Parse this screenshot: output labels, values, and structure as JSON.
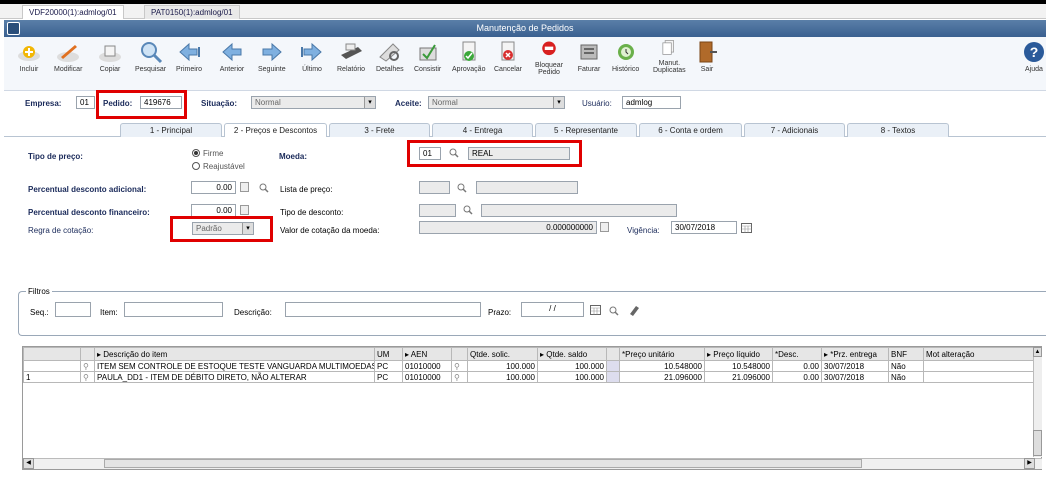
{
  "window_tabs": [
    {
      "label": "VDF20000(1):admlog/01",
      "active": true
    },
    {
      "label": "PAT0150(1):admlog/01",
      "active": false
    }
  ],
  "window_title": "Manutenção de Pedidos",
  "toolbar": {
    "incluir": "Incluir",
    "modificar": "Modificar",
    "copiar": "Copiar",
    "pesquisar": "Pesquisar",
    "primeiro": "Primeiro",
    "anterior": "Anterior",
    "seguinte": "Seguinte",
    "ultimo": "Último",
    "relatorio": "Relatório",
    "detalhes": "Detalhes",
    "consistir": "Consistir",
    "aprovacao": "Aprovação",
    "cancelar": "Cancelar",
    "bloquear_l1": "Bloquear",
    "bloquear_l2": "Pedido",
    "faturar": "Faturar",
    "historico": "Histórico",
    "manut_l1": "Manut.",
    "manut_l2": "Duplicatas",
    "sair": "Sair",
    "ajuda": "Ajuda"
  },
  "header": {
    "empresa_label": "Empresa:",
    "empresa_value": "01",
    "pedido_label": "Pedido:",
    "pedido_value": "419676",
    "situacao_label": "Situação:",
    "situacao_value": "Normal",
    "aceite_label": "Aceite:",
    "aceite_value": "Normal",
    "usuario_label": "Usuário:",
    "usuario_value": "admlog"
  },
  "form_tabs": [
    {
      "label": "1 - Principal",
      "active": false
    },
    {
      "label": "2 - Preços e Descontos",
      "active": true
    },
    {
      "label": "3 - Frete",
      "active": false
    },
    {
      "label": "4 - Entrega",
      "active": false
    },
    {
      "label": "5 - Representante",
      "active": false
    },
    {
      "label": "6 - Conta e ordem",
      "active": false
    },
    {
      "label": "7 - Adicionais",
      "active": false
    },
    {
      "label": "8 - Textos",
      "active": false
    }
  ],
  "precos": {
    "tipo_preco_label": "Tipo de preço:",
    "firme": "Firme",
    "reajustavel": "Reajustável",
    "moeda_label": "Moeda:",
    "moeda_code": "01",
    "moeda_name": "REAL",
    "perc_adicional_label": "Percentual desconto adicional:",
    "perc_adicional_value": "0.00",
    "lista_preco_label": "Lista de preço:",
    "lista_preco_code": "",
    "lista_preco_name": "",
    "perc_financeiro_label": "Percentual desconto financeiro:",
    "perc_financeiro_value": "0.00",
    "tipo_desconto_label": "Tipo de desconto:",
    "tipo_desconto_code": "",
    "tipo_desconto_name": "",
    "regra_label": "Regra de cotação:",
    "regra_value": "Padrão",
    "valor_cotacao_label": "Valor de cotação da moeda:",
    "valor_cotacao_value": "0.000000000",
    "vigencia_label": "Vigência:",
    "vigencia_value": "30/07/2018"
  },
  "filtros": {
    "title": "Filtros",
    "seq_label": "Seq.:",
    "seq_value": "",
    "item_label": "Item:",
    "item_value": "",
    "descricao_label": "Descrição:",
    "descricao_value": "",
    "prazo_label": "Prazo:",
    "prazo_value": "/ /"
  },
  "grid": {
    "columns": [
      "",
      "",
      "Descrição do item",
      "UM",
      "AEN",
      "",
      "Qtde. solic.",
      "Qtde. saldo",
      "",
      "*Preço unitário",
      "Preço líquido",
      "*Desc.",
      "*Prz. entrega",
      "BNF",
      "Mot alteração"
    ],
    "rows": [
      {
        "seq": "",
        "descricao": "ITEM SEM CONTROLE DE ESTOQUE TESTE VANGUARDA MULTIMOEDAS",
        "um": "PC",
        "aen": "01010000",
        "qtde_solic": "100.000",
        "qtde_saldo": "100.000",
        "preco_unit": "10.548000",
        "preco_liq": "10.548000",
        "desc": "0.00",
        "prz": "30/07/2018",
        "bnf": "Não",
        "mot": ""
      },
      {
        "seq": "1",
        "descricao": "PAULA_DD1 - ITEM DE DÉBITO DIRETO, NÃO ALTERAR",
        "um": "PC",
        "aen": "01010000",
        "qtde_solic": "100.000",
        "qtde_saldo": "100.000",
        "preco_unit": "21.096000",
        "preco_liq": "21.096000",
        "desc": "0.00",
        "prz": "30/07/2018",
        "bnf": "Não",
        "mot": ""
      }
    ]
  },
  "colors": {
    "title_bar": "#3a6090",
    "highlight": "#e00000",
    "tab_text": "#1a2a5a"
  }
}
